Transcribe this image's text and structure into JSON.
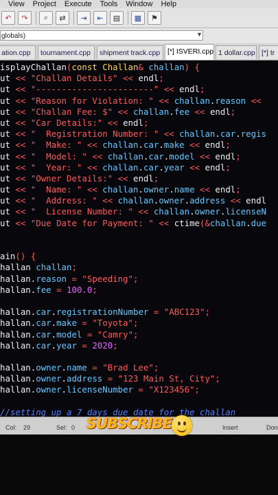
{
  "menu": [
    "View",
    "Project",
    "Execute",
    "Tools",
    "Window",
    "Help"
  ],
  "toolbar": {
    "icons": [
      "undo-icon",
      "redo-icon",
      "find-icon",
      "replace-icon",
      "indent-icon",
      "unindent-icon",
      "toggle-comment-icon",
      "goto-icon",
      "bookmark-icon"
    ]
  },
  "scope": {
    "value": "globals)"
  },
  "tabs": [
    "ation.cpp",
    "tournament.cpp",
    "shipment track.cpp",
    "[*] ISVERI.cpp",
    "1 dollar.cpp",
    "[*] tr"
  ],
  "code_lines": [
    "isplayChallan(const Challan& challan) {",
    "ut << \"Challan Details\" << endl;",
    "ut << \"-----------------------\" << endl;",
    "ut << \"Reason for Violation: \" << challan.reason <<",
    "ut << \"Challan Fee: $\" << challan.fee << endl;",
    "ut << \"Car Details:\" << endl;",
    "ut << \"  Registration Number: \" << challan.car.regis",
    "ut << \"  Make: \" << challan.car.make << endl;",
    "ut << \"  Model: \" << challan.car.model << endl;",
    "ut << \"  Year: \" << challan.car.year << endl;",
    "ut << \"Owner Details:\" << endl;",
    "ut << \"  Name: \" << challan.owner.name << endl;",
    "ut << \"  Address: \" << challan.owner.address << endl",
    "ut << \"  License Number: \" << challan.owner.licenseN",
    "ut << \"Due Date for Payment: \" << ctime(&challan.due",
    "",
    "",
    "ain() {",
    "hallan challan;",
    "hallan.reason = \"Speeding\";",
    "hallan.fee = 100.0;",
    "",
    "hallan.car.registrationNumber = \"ABC123\";",
    "hallan.car.make = \"Toyota\";",
    "hallan.car.model = \"Camry\";",
    "hallan.car.year = 2020;",
    "",
    "hallan.owner.name = \"Brad Lee\";",
    "hallan.owner.address = \"123 Main St, City\";",
    "hallan.owner.licenseNumber = \"X123456\";",
    "",
    "//setting up a 7 days due date for the challan"
  ],
  "status": {
    "col_label": "Col:",
    "col_value": "29",
    "sel_label": "Sel:",
    "sel_value": "0",
    "insert": "Insert",
    "done": "Don"
  },
  "overlay": {
    "subscribe_text": "SUBSCRIBE"
  }
}
